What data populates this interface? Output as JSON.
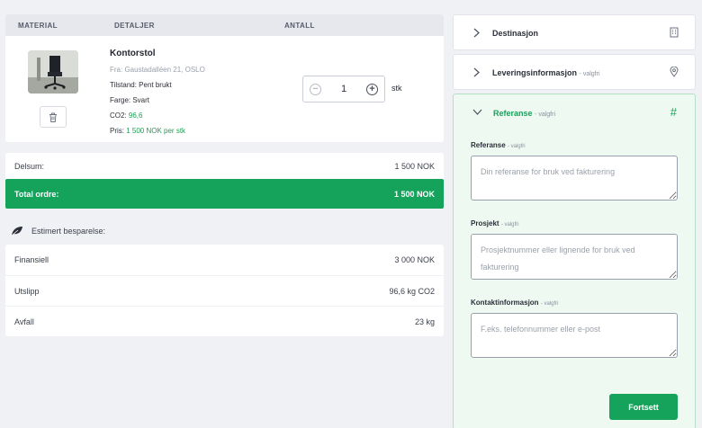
{
  "cart": {
    "columns": [
      "MATERIAL",
      "DETALJER",
      "ANTALL"
    ],
    "item": {
      "name": "Kontorstol",
      "from": "Fra: Gaustadalléen 21, OSLO",
      "condition": "Tilstand: Pent brukt",
      "color": "Farge: Svart",
      "co2_label": "CO2:",
      "co2_value": "96,6",
      "price_label": "Pris:",
      "price_value": "1 500 NOK per stk",
      "quantity": "1",
      "unit": "stk",
      "icons": [
        "office-chair-image",
        "trash-icon",
        "minus-circle-icon",
        "plus-circle-icon"
      ]
    }
  },
  "totals": {
    "subtotal_label": "Delsum:",
    "subtotal_value": "1 500 NOK",
    "total_label": "Total ordre:",
    "total_value": "1 500 NOK"
  },
  "savings": {
    "title": "Estimert besparelse:",
    "icon": "leaf-icon",
    "rows": [
      {
        "label": "Finansiell",
        "value": "3 000 NOK"
      },
      {
        "label": "Utslipp",
        "value": "96,6 kg CO2"
      },
      {
        "label": "Avfall",
        "value": "23 kg"
      }
    ]
  },
  "sidebar": {
    "destination": {
      "title": "Destinasjon",
      "icon": "building-icon"
    },
    "delivery": {
      "title": "Leveringsinformasjon",
      "optional": "- valgfri",
      "icon": "location-pin-icon"
    },
    "reference": {
      "title": "Referanse",
      "optional": "- valgfri",
      "icon": "hash-icon",
      "fields": [
        {
          "label": "Referanse",
          "optional": "- valgfri",
          "placeholder": "Din referanse for bruk ved fakturering",
          "value": ""
        },
        {
          "label": "Prosjekt",
          "optional": "- valgfri",
          "placeholder": "Prosjektnummer eller lignende for bruk ved fakturering",
          "value": ""
        },
        {
          "label": "Kontaktinformasjon",
          "optional": "- valgfri",
          "placeholder": "F.eks. telefonnummer eller e-post",
          "value": ""
        }
      ],
      "continue_label": "Fortsett"
    }
  },
  "colors": {
    "accent": "#15a35c",
    "panel_bg": "#eef9f2",
    "page_bg": "#f0f1f5"
  }
}
